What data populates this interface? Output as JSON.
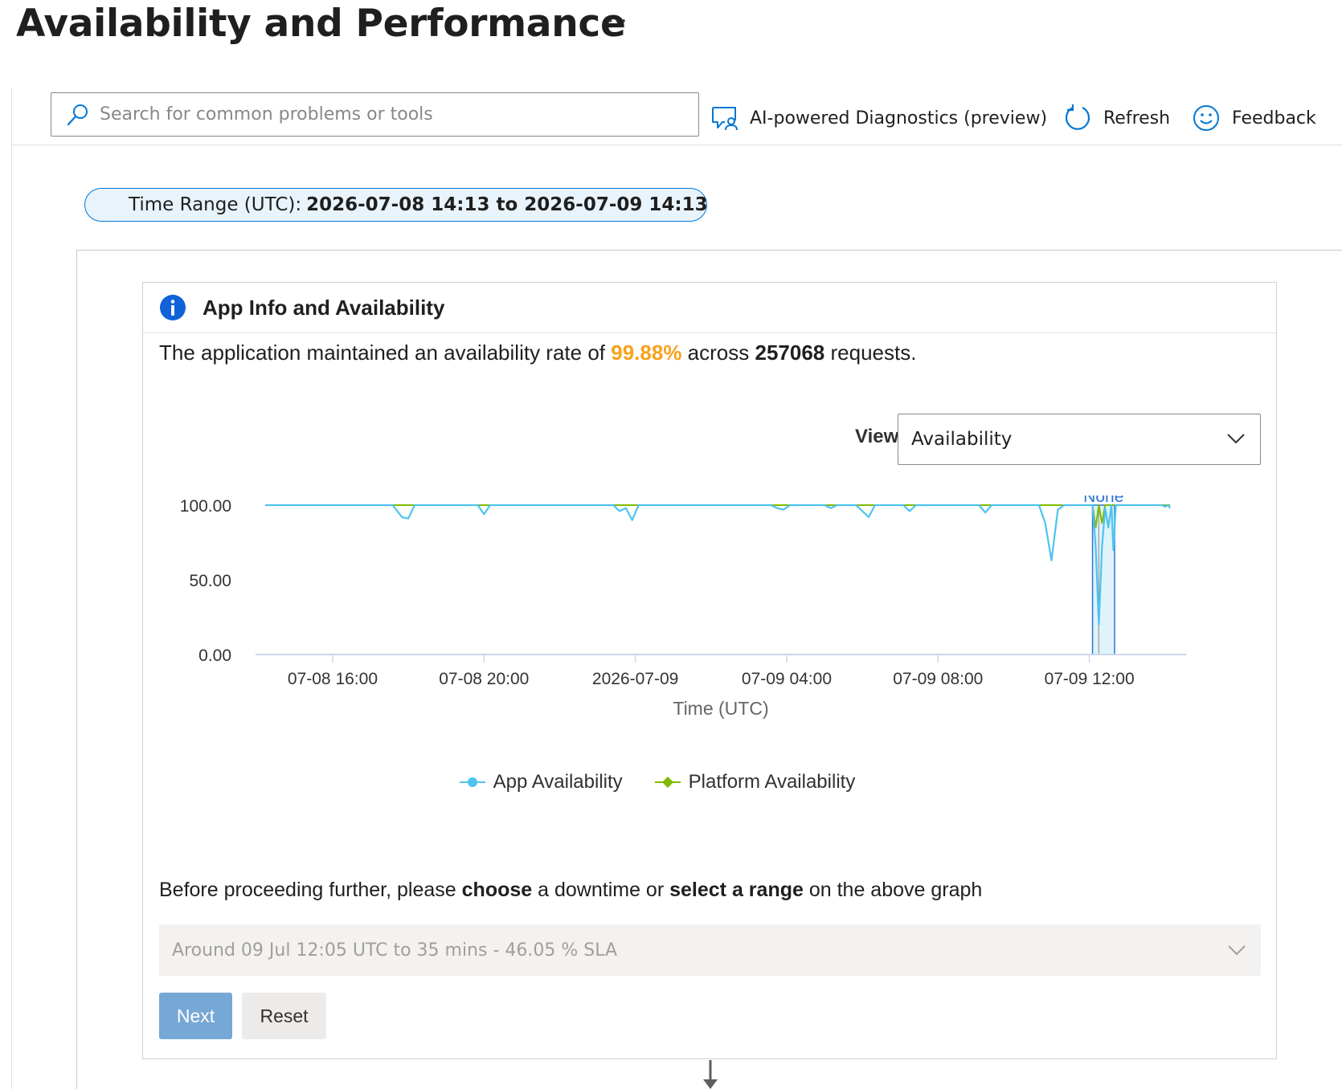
{
  "header": {
    "title": "Availability and Performance",
    "more_label": "···"
  },
  "toolbar": {
    "search_placeholder": "Search for common problems or tools",
    "ai_diagnostics_label": "AI-powered Diagnostics (preview)",
    "refresh_label": "Refresh",
    "feedback_label": "Feedback"
  },
  "time_range": {
    "label": "Time Range (UTC):",
    "value": "2026-07-08 14:13 to 2026-07-09 14:13"
  },
  "card": {
    "title": "App Info and Availability",
    "summary_prefix": "The application maintained an availability rate of",
    "availability_rate": "99.88%",
    "summary_middle": "across",
    "request_count": "257068",
    "summary_suffix": "requests.",
    "view_label": "View",
    "view_selected": "Availability"
  },
  "chart_data": {
    "type": "line",
    "xlabel": "Time (UTC)",
    "ylabel": "",
    "ylim": [
      0,
      100
    ],
    "y_ticks": [
      "100.00",
      "50.00",
      "0.00"
    ],
    "x_ticks": [
      "07-08 16:00",
      "07-08 20:00",
      "2026-07-09",
      "07-09 04:00",
      "07-09 08:00",
      "07-09 12:00"
    ],
    "x_range": [
      "2026-07-08 14:13",
      "2026-07-09 14:13"
    ],
    "highlight": {
      "start": "2026-07-09 12:05",
      "end": "2026-07-09 12:40",
      "label": "None"
    },
    "series": [
      {
        "name": "App Availability",
        "color": "#4ec3f0",
        "points": [
          [
            "2026-07-08 14:13",
            100
          ],
          [
            "2026-07-08 17:35",
            100
          ],
          [
            "2026-07-08 17:50",
            92
          ],
          [
            "2026-07-08 18:00",
            91
          ],
          [
            "2026-07-08 18:10",
            100
          ],
          [
            "2026-07-08 19:50",
            100
          ],
          [
            "2026-07-08 20:00",
            94
          ],
          [
            "2026-07-08 20:10",
            100
          ],
          [
            "2026-07-08 23:25",
            100
          ],
          [
            "2026-07-08 23:35",
            96
          ],
          [
            "2026-07-08 23:45",
            98
          ],
          [
            "2026-07-08 23:55",
            90
          ],
          [
            "2026-07-09 00:05",
            100
          ],
          [
            "2026-07-09 03:35",
            100
          ],
          [
            "2026-07-09 03:45",
            98
          ],
          [
            "2026-07-09 03:55",
            97
          ],
          [
            "2026-07-09 04:05",
            100
          ],
          [
            "2026-07-09 05:00",
            100
          ],
          [
            "2026-07-09 05:10",
            98
          ],
          [
            "2026-07-09 05:20",
            100
          ],
          [
            "2026-07-09 05:50",
            100
          ],
          [
            "2026-07-09 06:00",
            96
          ],
          [
            "2026-07-09 06:10",
            92
          ],
          [
            "2026-07-09 06:20",
            100
          ],
          [
            "2026-07-09 07:05",
            100
          ],
          [
            "2026-07-09 07:15",
            96
          ],
          [
            "2026-07-09 07:25",
            100
          ],
          [
            "2026-07-09 09:05",
            100
          ],
          [
            "2026-07-09 09:15",
            95
          ],
          [
            "2026-07-09 09:25",
            100
          ],
          [
            "2026-07-09 10:40",
            100
          ],
          [
            "2026-07-09 10:50",
            88
          ],
          [
            "2026-07-09 11:00",
            63
          ],
          [
            "2026-07-09 11:10",
            97
          ],
          [
            "2026-07-09 11:20",
            100
          ],
          [
            "2026-07-09 12:05",
            100
          ],
          [
            "2026-07-09 12:10",
            72
          ],
          [
            "2026-07-09 12:15",
            20
          ],
          [
            "2026-07-09 12:20",
            72
          ],
          [
            "2026-07-09 12:25",
            98
          ],
          [
            "2026-07-09 12:30",
            85
          ],
          [
            "2026-07-09 12:35",
            100
          ],
          [
            "2026-07-09 12:38",
            70
          ],
          [
            "2026-07-09 12:42",
            100
          ],
          [
            "2026-07-09 13:55",
            100
          ],
          [
            "2026-07-09 14:00",
            99
          ],
          [
            "2026-07-09 14:05",
            100
          ],
          [
            "2026-07-09 14:08",
            98
          ]
        ]
      },
      {
        "name": "Platform Availability",
        "color": "#7fba00",
        "points": [
          [
            "2026-07-08 14:13",
            100
          ],
          [
            "2026-07-09 12:05",
            100
          ],
          [
            "2026-07-09 12:10",
            85
          ],
          [
            "2026-07-09 12:15",
            100
          ],
          [
            "2026-07-09 12:20",
            88
          ],
          [
            "2026-07-09 12:25",
            100
          ],
          [
            "2026-07-09 14:08",
            100
          ]
        ]
      }
    ]
  },
  "selection": {
    "prompt_part1": "Before proceeding further, please",
    "prompt_choose": "choose",
    "prompt_part2": "a downtime or",
    "prompt_select_range": "select a range",
    "prompt_part3": "on the above graph",
    "downtime_value": "Around 09 Jul 12:05 UTC to 35 mins - 46.05 % SLA",
    "next_label": "Next",
    "reset_label": "Reset"
  }
}
